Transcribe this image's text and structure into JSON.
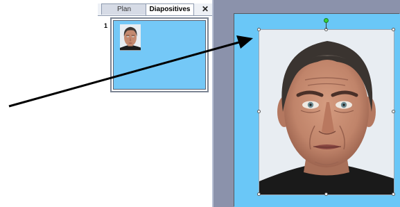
{
  "slides_pane": {
    "tabs": [
      {
        "label": "Plan",
        "active": false
      },
      {
        "label": "Diapositives",
        "active": true
      }
    ],
    "close_glyph": "✕",
    "slides": [
      {
        "number": "1",
        "thumbnail": "portrait-photo"
      }
    ]
  },
  "editor": {
    "slide_background": "#6ac7f7",
    "image": "portrait-photo",
    "selection_handles": 8,
    "rotation_handle_color": "#37d13b"
  },
  "annotation": {
    "type": "arrow",
    "color": "#000000"
  }
}
